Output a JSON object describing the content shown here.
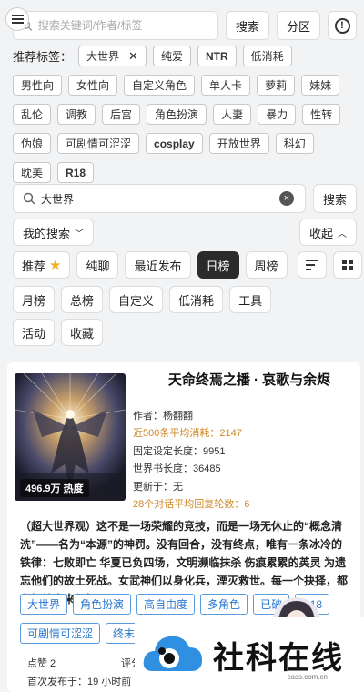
{
  "search": {
    "placeholder": "搜索关键词/作者/标签",
    "search_btn": "搜索",
    "category_btn": "分区",
    "info": "!"
  },
  "tags": {
    "label": "推荐标签：",
    "selected": "大世界",
    "row1": [
      "纯爱",
      "NTR",
      "低消耗"
    ],
    "row2": [
      "男性向",
      "女性向",
      "自定义角色",
      "单人卡",
      "萝莉",
      "妹妹"
    ],
    "row3": [
      "乱伦",
      "调教",
      "后宫",
      "角色扮演",
      "人妻",
      "暴力",
      "性转"
    ],
    "row4": [
      "伪娘",
      "可剧情可涩涩",
      "cosplay",
      "开放世界",
      "科幻"
    ],
    "row5": [
      "耽美",
      "R18"
    ]
  },
  "search2": {
    "value": "大世界",
    "clear": "×",
    "search_btn": "搜索"
  },
  "my_search": {
    "label": "我的搜索",
    "collapse": "收起"
  },
  "filters": {
    "row1": [
      "推荐",
      "纯聊",
      "最近发布",
      "日榜",
      "周榜"
    ],
    "active": "日榜",
    "row2": [
      "月榜",
      "总榜",
      "自定义",
      "低消耗",
      "工具"
    ],
    "row3": [
      "活动",
      "收藏"
    ]
  },
  "card": {
    "title": "天命终焉之播 · 哀歌与余烬",
    "heat": "496.9万 热度",
    "author": "作者：杨翻翻",
    "avg_cost": "近500条平均消耗：2147",
    "fixed_len": "固定设定长度：9951",
    "world_len": "世界书长度：36485",
    "update": "更新于：无",
    "avg_rounds": "28个对话平均回复轮数：6",
    "desc": "（超大世界观）这不是一场荣耀的竞技，而是一场无休止的“概念清洗”——名为“本源”的神罚。没有回合，没有终点，唯有一条冰冷的铁律：七败即亡 华夏已负四场，文明濒临抹杀 伤痕累累的英灵 为遗忘他们的故土死战。女武神们以身化兵，湮灭救世。每一个抉择，都在牺牲未来与牺...",
    "chips1": [
      "大世界",
      "角色扮演",
      "高自由度",
      "多角色",
      "已破",
      "R18"
    ],
    "chips2": [
      "可剧情可涩涩",
      "终末"
    ],
    "likes": "点赞 2",
    "rating": "评分",
    "first_pub": "首次发布于：19 小时前"
  },
  "watermark": {
    "text": "社科在线",
    "url": "cass.com.cn"
  },
  "colors": {
    "accent_blue": "#2a78cf",
    "orange": "#d08a2a",
    "active": "#2b2b2b"
  }
}
